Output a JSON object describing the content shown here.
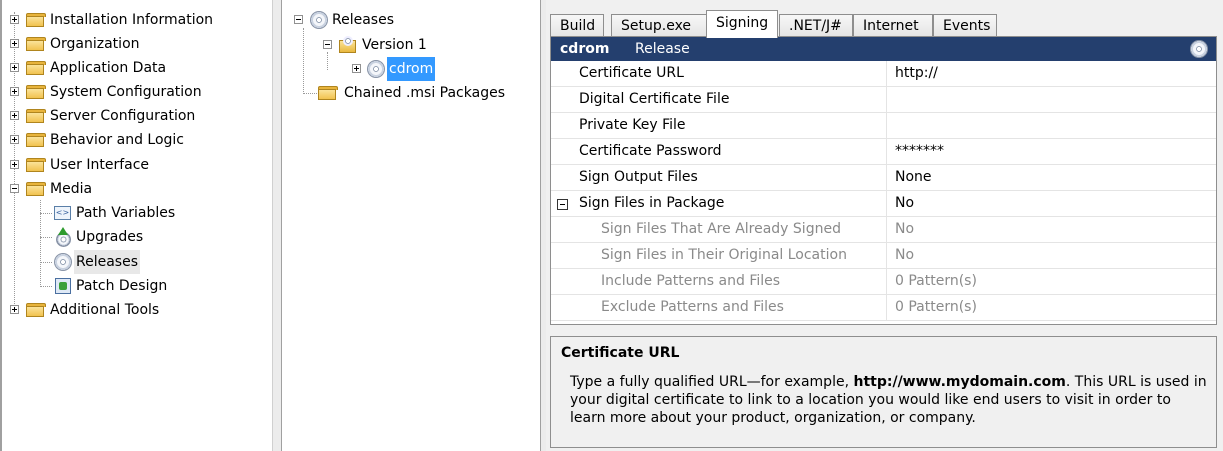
{
  "left_tree": {
    "items": [
      {
        "label": "Installation Information",
        "expander": "plus"
      },
      {
        "label": "Organization",
        "expander": "plus"
      },
      {
        "label": "Application Data",
        "expander": "plus"
      },
      {
        "label": "System Configuration",
        "expander": "plus"
      },
      {
        "label": "Server Configuration",
        "expander": "plus"
      },
      {
        "label": "Behavior and Logic",
        "expander": "plus"
      },
      {
        "label": "User Interface",
        "expander": "plus"
      },
      {
        "label": "Media",
        "expander": "minus"
      },
      {
        "label": "Path Variables",
        "icon": "path-variables-icon"
      },
      {
        "label": "Upgrades",
        "icon": "upgrades-icon"
      },
      {
        "label": "Releases",
        "icon": "disc-icon",
        "state": "hovered"
      },
      {
        "label": "Patch Design",
        "icon": "patch-design-icon"
      },
      {
        "label": "Additional Tools",
        "expander": "plus"
      }
    ]
  },
  "mid_tree": {
    "releases": "Releases",
    "version": "Version 1",
    "cdrom": "cdrom",
    "chained": "Chained .msi Packages"
  },
  "tabs": [
    "Build",
    "Setup.exe",
    "Signing",
    ".NET/J#",
    "Internet",
    "Events"
  ],
  "active_tab": "Signing",
  "grid": {
    "header_name": "cdrom",
    "header_type": "Release",
    "rows": [
      {
        "name": "Certificate URL",
        "value": "http://"
      },
      {
        "name": "Digital Certificate File",
        "value": ""
      },
      {
        "name": "Private Key File",
        "value": ""
      },
      {
        "name": "Certificate Password",
        "value": "*******"
      },
      {
        "name": "Sign Output Files",
        "value": "None"
      },
      {
        "name": "Sign Files in Package",
        "value": "No"
      },
      {
        "name": "Sign Files That Are Already Signed",
        "value": "No"
      },
      {
        "name": "Sign Files in Their Original Location",
        "value": "No"
      },
      {
        "name": "Include Patterns and Files",
        "value": "0 Pattern(s)"
      },
      {
        "name": "Exclude Patterns and Files",
        "value": "0 Pattern(s)"
      }
    ]
  },
  "description": {
    "title": "Certificate URL",
    "text_before": "Type a fully qualified URL—for example, ",
    "text_bold": "http://www.mydomain.com",
    "text_after": ". This URL is used in your digital certificate to link to a location you would like end users to visit in order to learn more about your product, organization, or company."
  },
  "colors": {
    "header_bg": "#243f6e",
    "selection": "#3399ff"
  }
}
